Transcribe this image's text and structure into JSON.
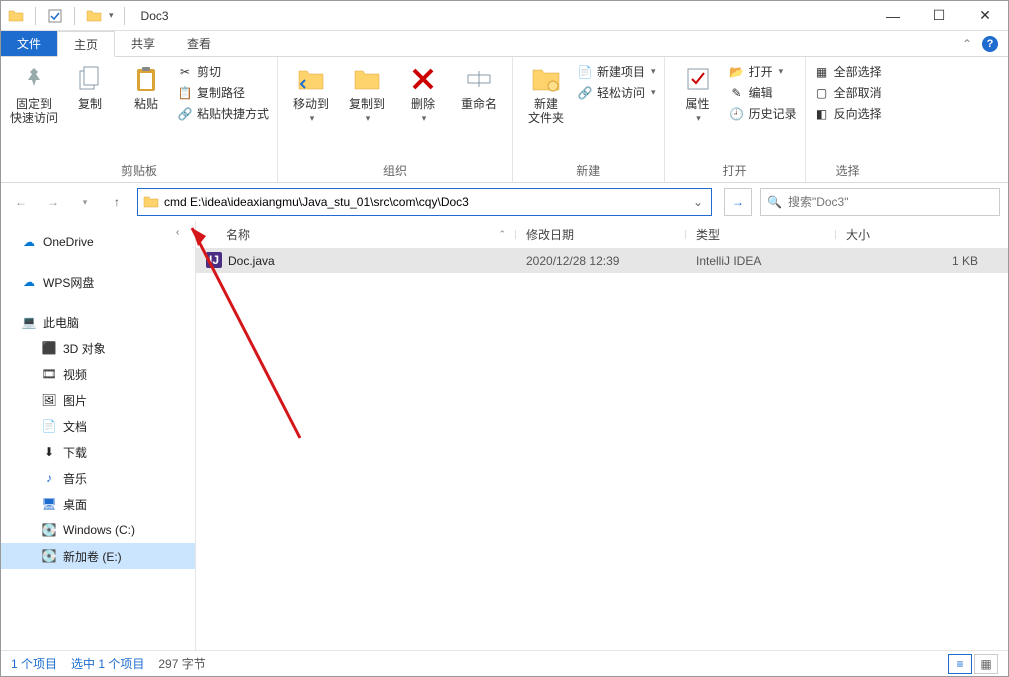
{
  "titlebar": {
    "title": "Doc3"
  },
  "tabs": {
    "file": "文件",
    "home": "主页",
    "share": "共享",
    "view": "查看"
  },
  "ribbon": {
    "clipboard": {
      "label": "剪贴板",
      "pin": "固定到\n快速访问",
      "copy": "复制",
      "paste": "粘贴",
      "cut": "剪切",
      "copypath": "复制路径",
      "pasteshort": "粘贴快捷方式"
    },
    "organize": {
      "label": "组织",
      "moveto": "移动到",
      "copyto": "复制到",
      "delete": "删除",
      "rename": "重命名"
    },
    "new": {
      "label": "新建",
      "newfolder": "新建\n文件夹",
      "newitem": "新建项目",
      "easyaccess": "轻松访问"
    },
    "open": {
      "label": "打开",
      "properties": "属性",
      "open": "打开",
      "edit": "编辑",
      "history": "历史记录"
    },
    "select": {
      "label": "选择",
      "selectall": "全部选择",
      "selectnone": "全部取消",
      "invert": "反向选择"
    }
  },
  "nav": {
    "address_prefix": "cmd ",
    "address_path": "E:\\idea\\ideaxiangmu\\Java_stu_01\\src\\com\\cqy\\Doc3",
    "search_placeholder": "搜索\"Doc3\""
  },
  "sidebar": {
    "onedrive": "OneDrive",
    "wps": "WPS网盘",
    "thispc": "此电脑",
    "objects3d": "3D 对象",
    "videos": "视频",
    "pictures": "图片",
    "documents": "文档",
    "downloads": "下载",
    "music": "音乐",
    "desktop": "桌面",
    "cdrive": "Windows (C:)",
    "edrive": "新加卷 (E:)"
  },
  "columns": {
    "name": "名称",
    "date": "修改日期",
    "type": "类型",
    "size": "大小"
  },
  "files": [
    {
      "name": "Doc.java",
      "date": "2020/12/28 12:39",
      "type": "IntelliJ IDEA",
      "size": "1 KB"
    }
  ],
  "status": {
    "count": "1 个项目",
    "sel": "选中 1 个项目",
    "bytes": "297 字节"
  }
}
